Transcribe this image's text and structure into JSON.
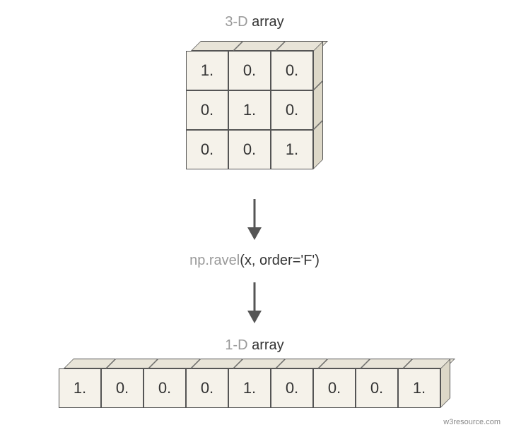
{
  "labels": {
    "top_dim": "3-D",
    "top_word": " array",
    "mid_func": "np.ravel",
    "mid_args": "(x, order='F')",
    "bot_dim": "1-D",
    "bot_word": " array"
  },
  "grid": [
    [
      "1.",
      "0.",
      "0."
    ],
    [
      "0.",
      "1.",
      "0."
    ],
    [
      "0.",
      "0.",
      "1."
    ]
  ],
  "row": [
    "1.",
    "0.",
    "0.",
    "0.",
    "1.",
    "0.",
    "0.",
    "0.",
    "1."
  ],
  "watermark": "w3resource.com",
  "chart_data": {
    "type": "table",
    "description": "Illustration of flattening a 3x3 identity-like float array into a 1-D array using np.ravel with Fortran (column-major) order",
    "input_shape": [
      3,
      3
    ],
    "input": [
      [
        1.0,
        0.0,
        0.0
      ],
      [
        0.0,
        1.0,
        0.0
      ],
      [
        0.0,
        0.0,
        1.0
      ]
    ],
    "operation": "np.ravel(x, order='F')",
    "output": [
      1.0,
      0.0,
      0.0,
      0.0,
      1.0,
      0.0,
      0.0,
      0.0,
      1.0
    ]
  }
}
